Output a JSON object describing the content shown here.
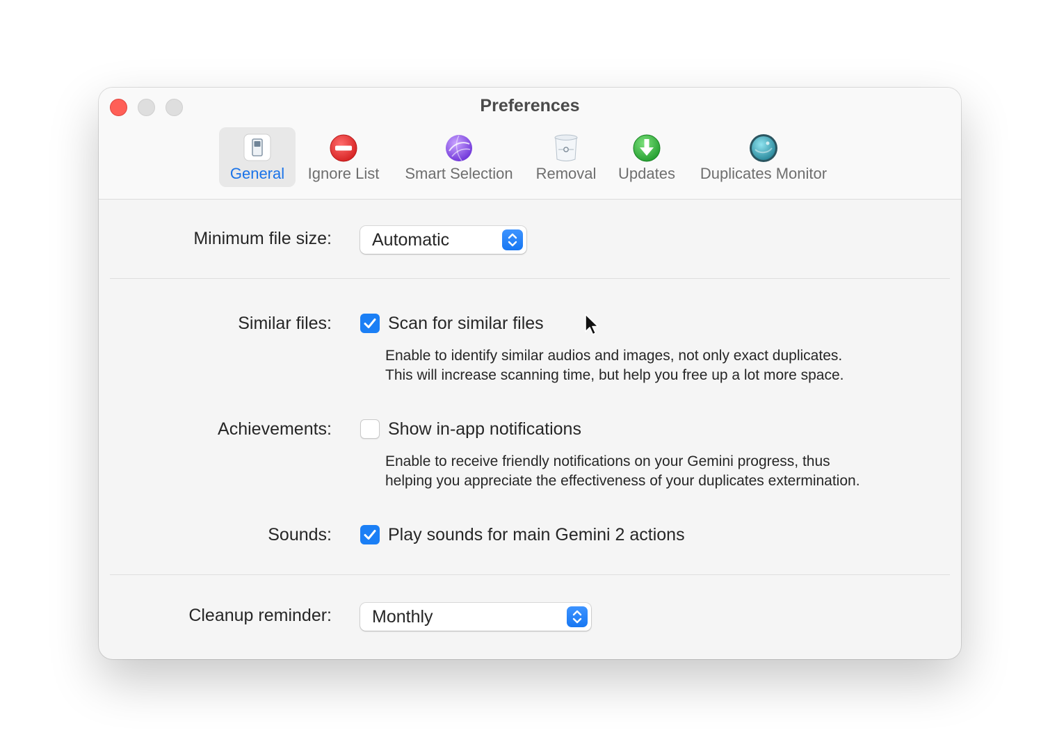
{
  "window": {
    "title": "Preferences"
  },
  "toolbar": {
    "items": [
      {
        "label": "General",
        "icon": "general-switch-icon",
        "selected": true
      },
      {
        "label": "Ignore List",
        "icon": "no-entry-icon",
        "selected": false
      },
      {
        "label": "Smart Selection",
        "icon": "purple-globe-icon",
        "selected": false
      },
      {
        "label": "Removal",
        "icon": "trash-bin-icon",
        "selected": false
      },
      {
        "label": "Updates",
        "icon": "green-download-arrow-icon",
        "selected": false
      },
      {
        "label": "Duplicates Monitor",
        "icon": "teal-monitor-globe-icon",
        "selected": false
      }
    ]
  },
  "settings": {
    "min_file_size": {
      "label": "Minimum file size:",
      "value": "Automatic"
    },
    "similar_files": {
      "label": "Similar files:",
      "checkbox_label": "Scan for similar files",
      "checked": true,
      "description_line1": "Enable to identify similar audios and images, not only exact duplicates.",
      "description_line2": "This will increase scanning time, but help you free up a lot more space."
    },
    "achievements": {
      "label": "Achievements:",
      "checkbox_label": "Show in-app notifications",
      "checked": false,
      "description_line1": "Enable to receive friendly notifications on your Gemini progress, thus",
      "description_line2": "helping you appreciate the effectiveness of your duplicates extermination."
    },
    "sounds": {
      "label": "Sounds:",
      "checkbox_label": "Play sounds for main Gemini 2 actions",
      "checked": true
    },
    "cleanup_reminder": {
      "label": "Cleanup reminder:",
      "value": "Monthly"
    }
  },
  "colors": {
    "accent": "#1b7ff5",
    "close_button": "#ff5f57",
    "selected_tab_text": "#1a73e8"
  }
}
